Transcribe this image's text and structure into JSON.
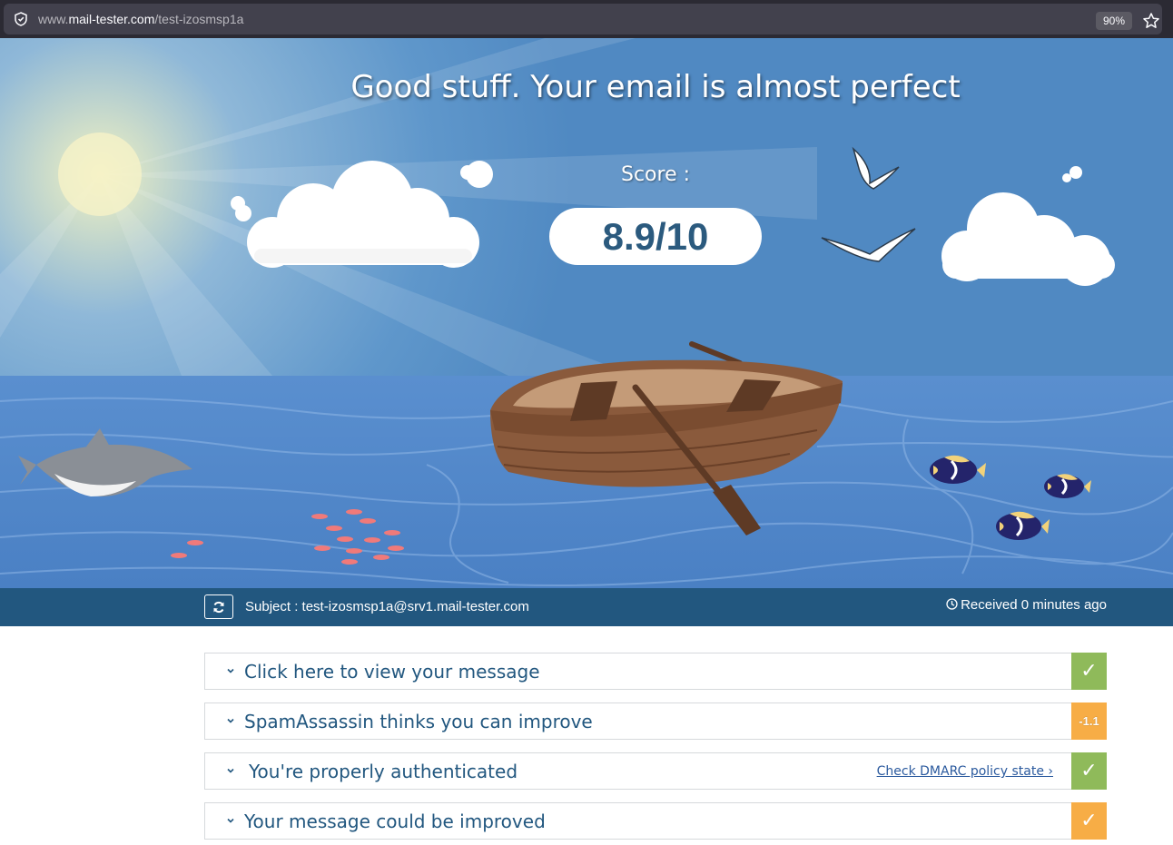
{
  "browser": {
    "url_prefix": "www.",
    "url_domain": "mail-tester.com",
    "url_path": "/test-izosmsp1a",
    "zoom": "90%"
  },
  "hero": {
    "title": "Good stuff. Your email is almost perfect",
    "score_label": "Score :",
    "score": "8.9/10",
    "sky_color": "#4f8fc8",
    "sea_color": "#4f86c6"
  },
  "subject_bar": {
    "subject": "Subject : test-izosmsp1a@srv1.mail-tester.com",
    "received": "Received 0 minutes ago"
  },
  "results": [
    {
      "title": "Click here to view your message",
      "badge": "✓",
      "status": "pass"
    },
    {
      "title": "SpamAssassin thinks you can improve",
      "badge": "-1.1",
      "status": "warn"
    },
    {
      "title": "You're properly authenticated",
      "badge": "✓",
      "status": "pass",
      "link": "Check DMARC policy state ›"
    },
    {
      "title": "Your message could be improved",
      "badge": "✓",
      "status": "warn"
    }
  ],
  "colors": {
    "pass": "#8fba5a",
    "warn": "#f7ad46",
    "brand": "#22577f"
  }
}
